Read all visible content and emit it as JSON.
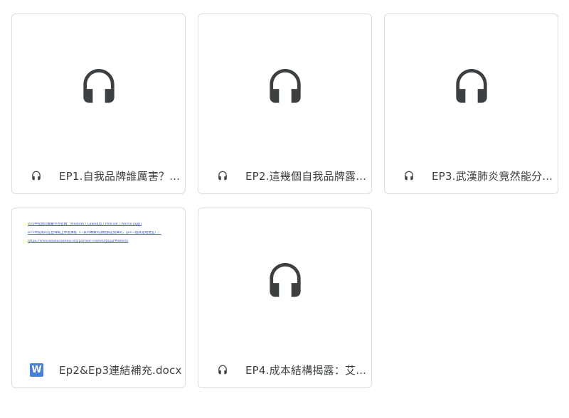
{
  "files": [
    {
      "name": "EP1.自我品牌誰厲害？...",
      "type_icon": "headphones-icon"
    },
    {
      "name": "EP2.這幾個自我品牌露...",
      "type_icon": "headphones-icon"
    },
    {
      "name": "EP3.武漢肺炎竟然能分...",
      "type_icon": "headphones-icon"
    },
    {
      "name": "Ep2&Ep3連結補充.docx",
      "type_icon": "word-doc-icon",
      "type_letter": "W",
      "preview_lines": [
        "EP2中提到的聯繫平台名稱：Medium / LinkedIn / Podcast / Wavve (app)",
        "EP3中提到的在台灣線上學習課程（一系列專業的課程都是免費的，gov一個就是啦便宜！）",
        "https://www.khanacademy.org/partner-content/pixar#effects"
      ]
    },
    {
      "name": "EP4.成本結構揭露：艾...",
      "type_icon": "headphones-icon"
    }
  ],
  "colors": {
    "border": "#dadce0",
    "icon": "#3c4043",
    "word_blue": "#4a7fd6",
    "link_blue": "#3d52c9"
  }
}
